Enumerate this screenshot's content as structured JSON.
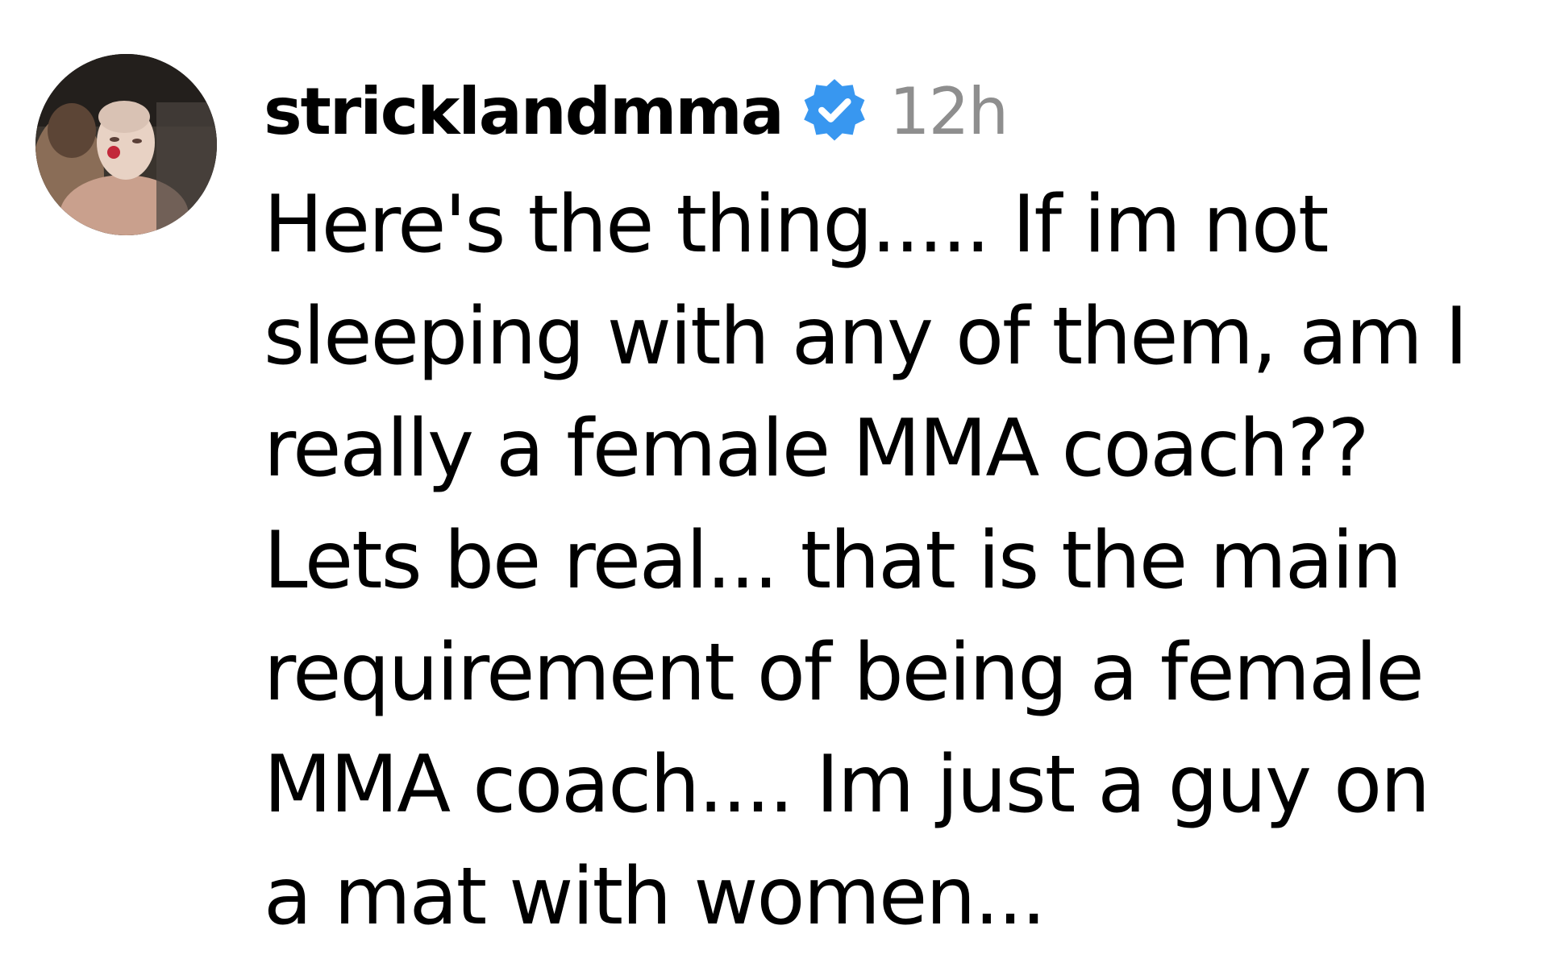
{
  "comment": {
    "username": "stricklandmma",
    "verified": true,
    "timestamp": "12h",
    "text": "Here's the thing..... If im not\nsleeping with any of them, am I\nreally a female MMA coach??\nLets be real... that is the main\nrequirement of being a female\nMMA coach.... Im just a guy on\na mat with women...",
    "avatar_icon": "user-avatar-photo",
    "badge_icon": "verified-badge-icon",
    "colors": {
      "username": "#000000",
      "timestamp": "#8e8e8e",
      "badge": "#3897f0",
      "text": "#000000",
      "background": "#ffffff"
    }
  }
}
